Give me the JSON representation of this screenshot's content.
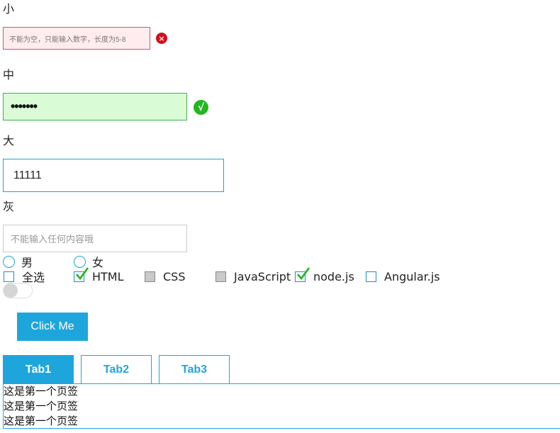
{
  "sections": {
    "small_label": "小",
    "medium_label": "中",
    "large_label": "大",
    "gray_label": "灰"
  },
  "inputs": {
    "small_value": "不能为空，只能输入数字，长度为5-8",
    "small_status": "error",
    "medium_value": "•••••••",
    "medium_status": "valid",
    "large_value": "11111",
    "gray_placeholder": "不能输入任何内容哦"
  },
  "status_icons": {
    "error_glyph": "×",
    "valid_glyph": "√"
  },
  "radios": [
    {
      "label": "男",
      "checked": false
    },
    {
      "label": "女",
      "checked": false
    }
  ],
  "checkboxes": [
    {
      "label": "全选",
      "state": "unchecked"
    },
    {
      "label": "HTML",
      "state": "checked"
    },
    {
      "label": "CSS",
      "state": "disabled"
    },
    {
      "label": "JavaScript",
      "state": "disabled"
    },
    {
      "label": "node.js",
      "state": "checked"
    },
    {
      "label": "Angular.js",
      "state": "unchecked"
    }
  ],
  "toggle": {
    "on": false
  },
  "button": {
    "label": "Click Me"
  },
  "tabs": {
    "items": [
      {
        "label": "Tab1",
        "active": true
      },
      {
        "label": "Tab2",
        "active": false
      },
      {
        "label": "Tab3",
        "active": false
      }
    ],
    "panel_lines": [
      "这是第一个页签",
      "这是第一个页签",
      "这是第一个页签"
    ]
  },
  "colors": {
    "accent": "#1ea6dc",
    "error_border": "#d0566c",
    "error_bg": "#ffecef",
    "valid_border": "#39b54a",
    "valid_bg": "#d9fbd6",
    "check_green": "#21b720"
  }
}
